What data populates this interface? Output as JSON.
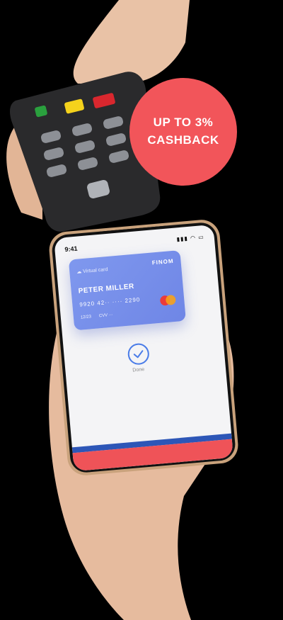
{
  "badge": {
    "line1": "UP TO 3%",
    "line2": "CASHBACK",
    "color": "#f2555a"
  },
  "phone": {
    "status_time": "9:41",
    "status_icons": "signal wifi battery",
    "card": {
      "label": "Virtual card",
      "brand": "FINOM",
      "holder": "PETER MILLER",
      "number": "9920  42··  ····  2290",
      "expiry": "12/23",
      "cvv": "CVV ···"
    },
    "done_label": "Done",
    "accent_color": "#4a7ce8"
  }
}
